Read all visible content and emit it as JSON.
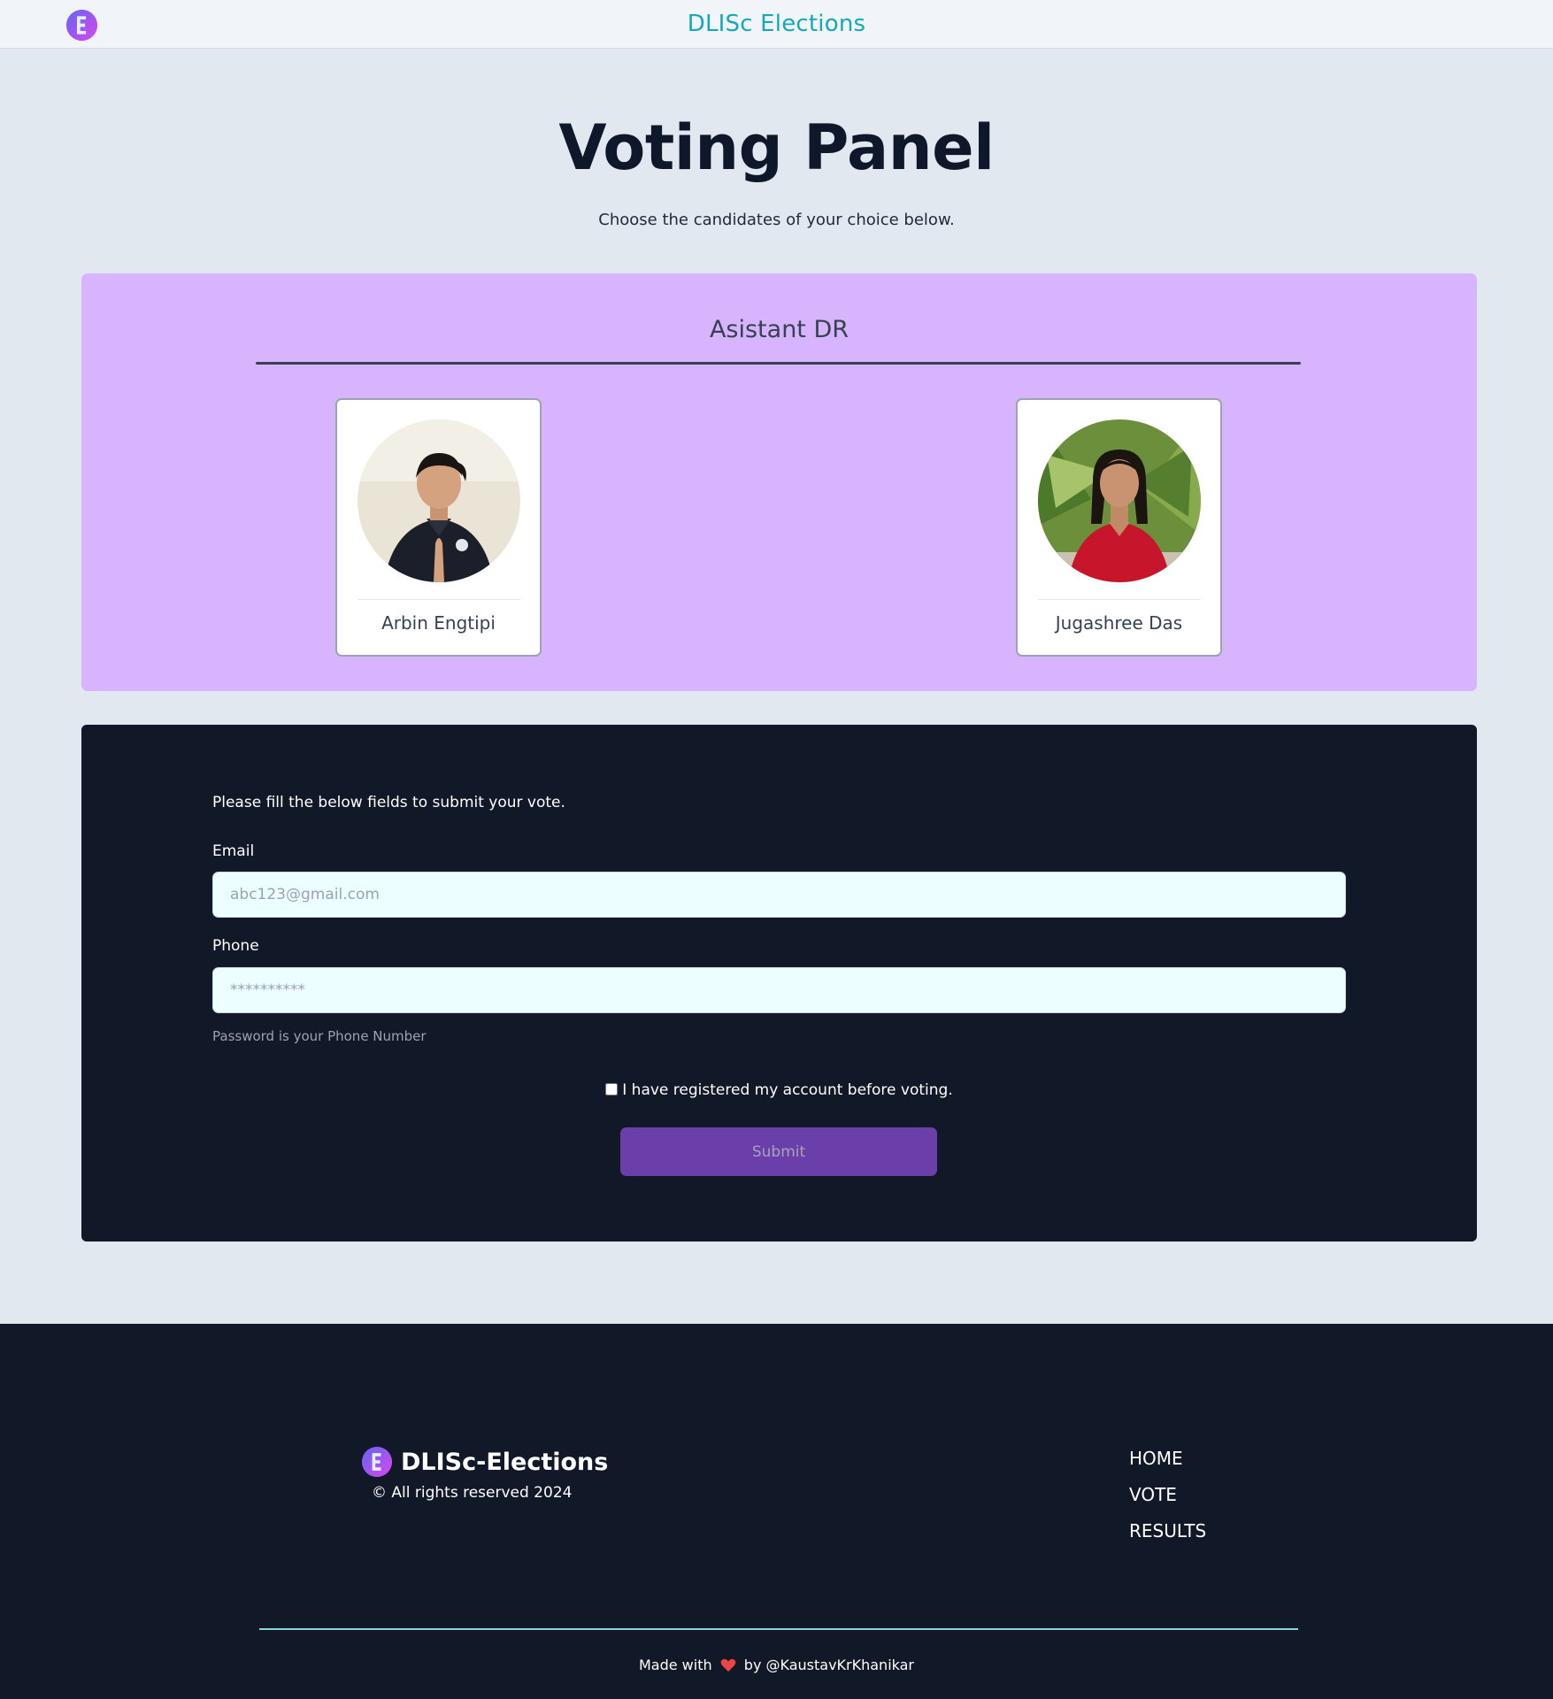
{
  "nav": {
    "brand": "DLISc Elections",
    "logo_icon": "election-logo-icon"
  },
  "header": {
    "title": "Voting Panel",
    "subtitle": "Choose the candidates of your choice below."
  },
  "position": {
    "title": "Asistant DR",
    "candidates": [
      {
        "name": "Arbin Engtipi"
      },
      {
        "name": "Jugashree Das"
      }
    ]
  },
  "vote_form": {
    "instruction": "Please fill the below fields to submit your vote.",
    "email_label": "Email",
    "email_placeholder": "abc123@gmail.com",
    "phone_label": "Phone",
    "phone_placeholder": "**********",
    "hint": "Password is your Phone Number",
    "consent_label": "I have registered my account before voting.",
    "submit_label": "Submit"
  },
  "footer": {
    "brand": "DLISc-Elections",
    "copyright": "© All rights reserved 2024",
    "links": [
      "HOME",
      "VOTE",
      "RESULTS"
    ],
    "credit_prefix": "Made with",
    "credit_suffix": "by @KaustavKrKhanikar"
  },
  "colors": {
    "page_bg": "#e2e8f0",
    "brand_teal": "#14a8b8",
    "position_bg": "#d8b4fe",
    "dark_panel": "#111827",
    "submit_bg": "#6b3fa9",
    "input_bg": "#ecfeff",
    "heart": "#ef4444"
  }
}
